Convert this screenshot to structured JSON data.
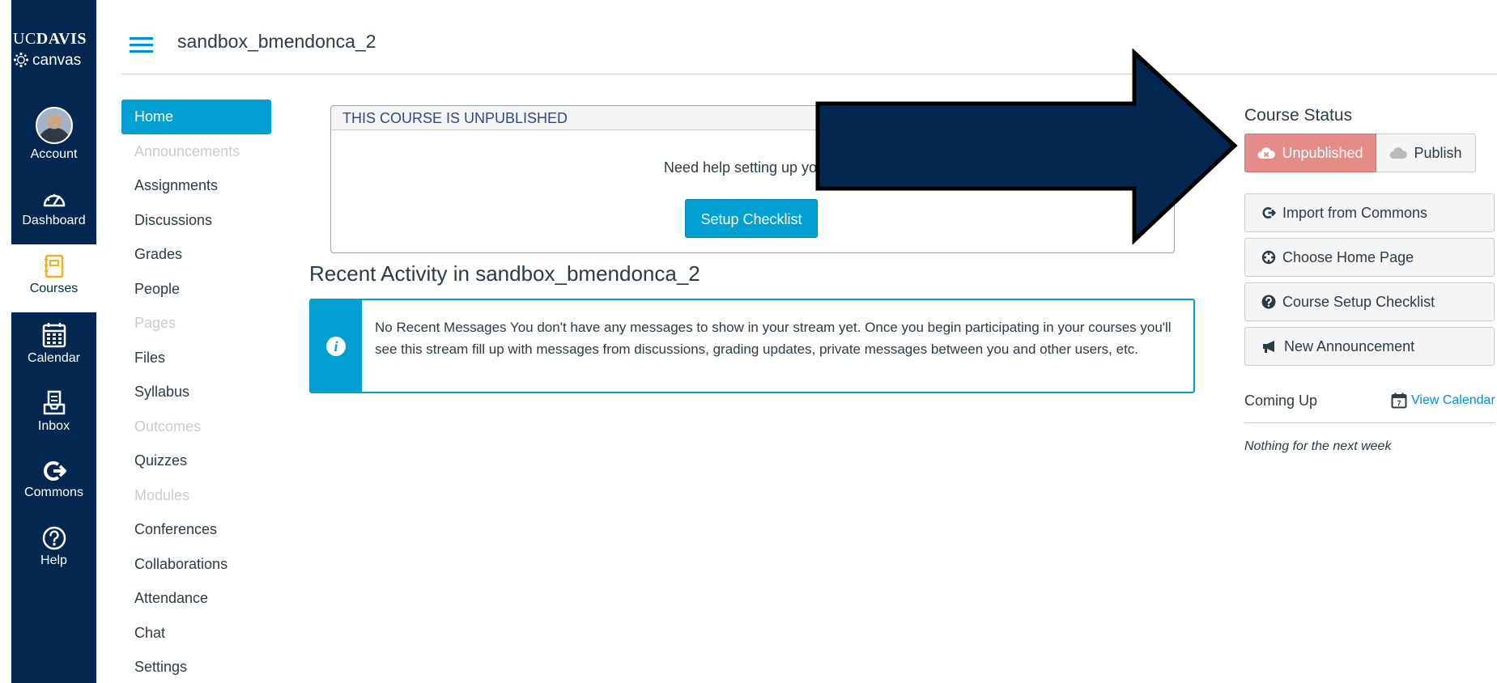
{
  "brand": {
    "uc": "UC",
    "davis": "DAVIS",
    "canvas": "canvas"
  },
  "global_nav": [
    {
      "label": "Account",
      "icon": "avatar"
    },
    {
      "label": "Dashboard",
      "icon": "dashboard-icon"
    },
    {
      "label": "Courses",
      "icon": "courses-icon",
      "active": true
    },
    {
      "label": "Calendar",
      "icon": "calendar-icon"
    },
    {
      "label": "Inbox",
      "icon": "inbox-icon"
    },
    {
      "label": "Commons",
      "icon": "commons-icon"
    },
    {
      "label": "Help",
      "icon": "help-icon"
    }
  ],
  "header": {
    "course_title": "sandbox_bmendonca_2"
  },
  "course_nav": [
    {
      "label": "Home",
      "state": "active"
    },
    {
      "label": "Announcements",
      "state": "disabled"
    },
    {
      "label": "Assignments",
      "state": "enabled"
    },
    {
      "label": "Discussions",
      "state": "enabled"
    },
    {
      "label": "Grades",
      "state": "enabled"
    },
    {
      "label": "People",
      "state": "enabled"
    },
    {
      "label": "Pages",
      "state": "disabled"
    },
    {
      "label": "Files",
      "state": "enabled"
    },
    {
      "label": "Syllabus",
      "state": "enabled"
    },
    {
      "label": "Outcomes",
      "state": "disabled"
    },
    {
      "label": "Quizzes",
      "state": "enabled"
    },
    {
      "label": "Modules",
      "state": "disabled"
    },
    {
      "label": "Conferences",
      "state": "enabled"
    },
    {
      "label": "Collaborations",
      "state": "enabled"
    },
    {
      "label": "Attendance",
      "state": "enabled"
    },
    {
      "label": "Chat",
      "state": "enabled"
    },
    {
      "label": "Settings",
      "state": "enabled"
    }
  ],
  "unpublished_notice": {
    "heading": "THIS COURSE IS UNPUBLISHED",
    "message": "Need help setting up your c",
    "button": "Setup Checklist"
  },
  "recent_activity": {
    "title": "Recent Activity in sandbox_bmendonca_2",
    "message": "No Recent Messages  You don't have any messages to show in your stream yet. Once you begin participating in your courses you'll see this stream fill up with messages from discussions, grading updates, private messages between you and other users, etc."
  },
  "sidebar": {
    "status_title": "Course Status",
    "unpublished_label": "Unpublished",
    "publish_label": "Publish",
    "buttons": [
      {
        "label": "Import from Commons",
        "icon": "commons-icon"
      },
      {
        "label": "Choose Home Page",
        "icon": "target-icon"
      },
      {
        "label": "Course Setup Checklist",
        "icon": "question-icon"
      },
      {
        "label": "New Announcement",
        "icon": "megaphone-icon"
      }
    ],
    "coming_up": "Coming Up",
    "view_calendar": "View Calendar",
    "calendar_day": "7",
    "nothing": "Nothing for the next week"
  },
  "colors": {
    "nav_bg": "#022851",
    "accent": "#00a0d2",
    "unpublished": "#e58c89",
    "arrow": "#022851"
  }
}
